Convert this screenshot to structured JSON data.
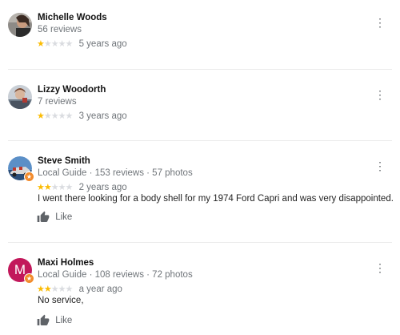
{
  "reviews": [
    {
      "name": "Michelle Woods",
      "meta": "56 reviews",
      "rating": 1,
      "time": "5 years ago",
      "avatar_icon": "profile-photo",
      "menu_icon": "more-vert-icon"
    },
    {
      "name": "Lizzy Woodorth",
      "meta": "7 reviews",
      "rating": 1,
      "time": "3 years ago",
      "avatar_icon": "profile-photo",
      "menu_icon": "more-vert-icon"
    },
    {
      "name": "Steve Smith",
      "meta": "Local Guide · 153 reviews · 57 photos",
      "rating": 2,
      "time": "2 years ago",
      "text": "I went there looking for a body shell for my 1974 Ford Capri and was very disappointed.",
      "like_label": "Like",
      "avatar_icon": "profile-photo",
      "badge_icon": "local-guide-star-icon"
    },
    {
      "name": "Maxi Holmes",
      "meta": "Local Guide · 108 reviews · 72 photos",
      "rating": 2,
      "time": "a year ago",
      "text": "No service,",
      "like_label": "Like",
      "avatar_letter": "M",
      "badge_icon": "local-guide-star-icon"
    }
  ],
  "colors": {
    "star_on": "#fbbc04",
    "star_off": "#dadce0",
    "avatar_letter_bg": "#c2185b",
    "guide_badge": "#f28b2c",
    "secondary_text": "#70757a"
  }
}
